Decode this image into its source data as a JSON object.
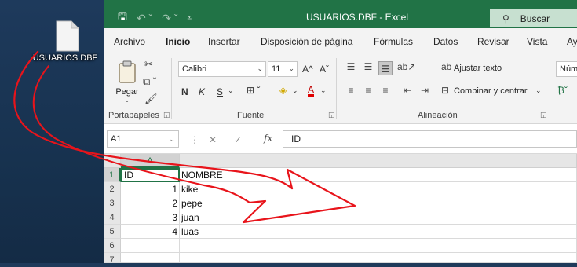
{
  "desktop": {
    "file_label": "USUARIOS.DBF",
    "file_icon": "document-icon"
  },
  "titlebar": {
    "title": "USUARIOS.DBF  -  Excel",
    "search_label": "Buscar",
    "qat_icons": [
      "save-icon",
      "undo-icon",
      "redo-icon",
      "customize-qat-icon"
    ]
  },
  "tabs": [
    "Archivo",
    "Inicio",
    "Insertar",
    "Disposición de página",
    "Fórmulas",
    "Datos",
    "Revisar",
    "Vista",
    "Ay"
  ],
  "ribbon": {
    "portapapeles": {
      "label": "Portapapeles",
      "paste_label": "Pegar"
    },
    "fuente": {
      "label": "Fuente",
      "font_name": "Calibri",
      "font_size": "11",
      "grow": "A^",
      "shrink": "Aˇ",
      "bold": "N",
      "italic": "K",
      "underline": "S",
      "font_color_letter": "A"
    },
    "alineacion": {
      "label": "Alineación",
      "wrap_text": "Ajustar texto",
      "merge_center": "Combinar y centrar"
    },
    "numero": {
      "format_value": "Núm"
    }
  },
  "formula_bar": {
    "name_box": "A1",
    "fx": "fx",
    "content": "ID"
  },
  "sheet": {
    "columns": [
      "A"
    ],
    "rows": [
      {
        "n": "1",
        "a": "ID",
        "b": "NOMBRE"
      },
      {
        "n": "2",
        "a": "1",
        "b": "kike"
      },
      {
        "n": "3",
        "a": "2",
        "b": "pepe"
      },
      {
        "n": "4",
        "a": "3",
        "b": "juan"
      },
      {
        "n": "5",
        "a": "4",
        "b": "luas"
      },
      {
        "n": "6",
        "a": "",
        "b": ""
      },
      {
        "n": "7",
        "a": "",
        "b": ""
      }
    ]
  },
  "colors": {
    "excel_green": "#217346",
    "annotation_red": "#e8141b"
  }
}
